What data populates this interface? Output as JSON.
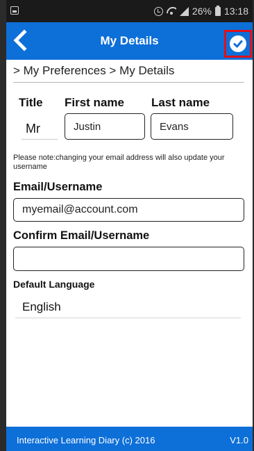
{
  "status_bar": {
    "battery_percent": "26%",
    "time": "13:18",
    "icons": [
      "notification-icon",
      "alarm-icon",
      "wifi-icon",
      "signal-icon",
      "battery-icon"
    ]
  },
  "header": {
    "title": "My Details",
    "back_icon": "chevron-left-icon",
    "confirm_icon": "check-circle-icon"
  },
  "breadcrumb": "> My Preferences > My Details",
  "form": {
    "title_label": "Title",
    "title_value": "Mr",
    "first_name_label": "First name",
    "first_name_value": "Justin",
    "last_name_label": "Last name",
    "last_name_value": "Evans",
    "note": "Please note:changing your email address will also update your username",
    "email_label": "Email/Username",
    "email_value": "myemail@account.com",
    "confirm_email_label": "Confirm Email/Username",
    "confirm_email_value": "",
    "language_label": "Default Language",
    "language_value": "English"
  },
  "footer": {
    "copyright": "Interactive Learning Diary (c) 2016",
    "version": "V1.0"
  },
  "colors": {
    "accent": "#0d6fd8",
    "highlight": "#e0101b",
    "status_bar": "#1a1a1a"
  }
}
